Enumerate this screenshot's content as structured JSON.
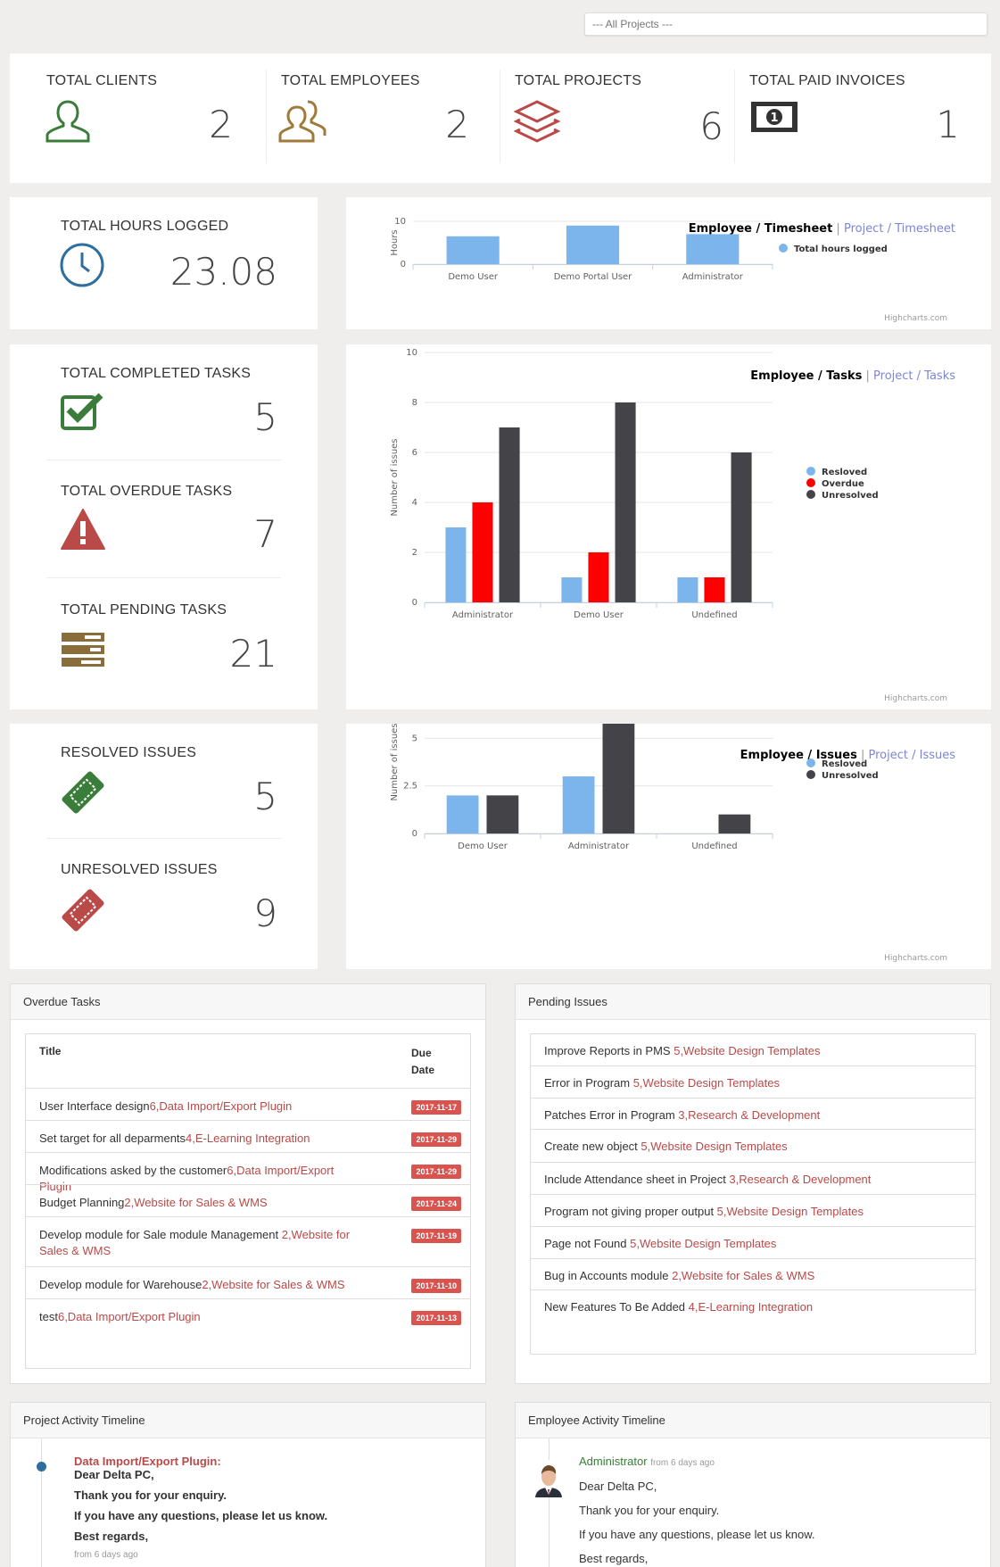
{
  "project_select": {
    "value": "--- All Projects ---"
  },
  "stats_top": [
    {
      "label": "TOTAL CLIENTS",
      "value": "2",
      "icon": "user-icon",
      "color": "#3a7d3a"
    },
    {
      "label": "TOTAL EMPLOYEES",
      "value": "2",
      "icon": "users-icon",
      "color": "#a07a3a"
    },
    {
      "label": "TOTAL PROJECTS",
      "value": "6",
      "icon": "layers-icon",
      "color": "#b94a48"
    },
    {
      "label": "TOTAL PAID INVOICES",
      "value": "1",
      "icon": "money-icon",
      "color": "#333333"
    }
  ],
  "hours": {
    "label": "TOTAL HOURS LOGGED",
    "value": "23.08",
    "icon": "clock-icon",
    "color": "#2f6f9f"
  },
  "tasks": [
    {
      "label": "TOTAL COMPLETED TASKS",
      "value": "5",
      "icon": "check-square-icon",
      "color": "#3a7d3a"
    },
    {
      "label": "TOTAL OVERDUE TASKS",
      "value": "7",
      "icon": "warning-icon",
      "color": "#b94a48"
    },
    {
      "label": "TOTAL PENDING TASKS",
      "value": "21",
      "icon": "tasks-icon",
      "color": "#8a6d3b"
    }
  ],
  "issues": [
    {
      "label": "RESOLVED ISSUES",
      "value": "5",
      "icon": "ticket-icon",
      "color": "#3a7d3a"
    },
    {
      "label": "UNRESOLVED ISSUES",
      "value": "9",
      "icon": "ticket-icon",
      "color": "#b94a48"
    }
  ],
  "chart_titles": {
    "timesheet": {
      "main": "Employee / Timesheet",
      "sep": " | ",
      "alt": "Project / Timesheet"
    },
    "tasks": {
      "main": "Employee / Tasks",
      "sep": " | ",
      "alt": "Project / Tasks"
    },
    "issues": {
      "main": "Employee / Issues",
      "sep": " | ",
      "alt": "Project / Issues"
    }
  },
  "credits": "Highcharts.com",
  "chart_data": [
    {
      "type": "bar",
      "categories": [
        "Demo User",
        "Demo Portal User",
        "Administrator"
      ],
      "series": [
        {
          "name": "Total hours logged",
          "values": [
            6.5,
            9,
            7
          ],
          "color": "#7cb5ec"
        }
      ],
      "ylabel": "Hours",
      "ylim": [
        0,
        10
      ],
      "yticks": [
        0,
        10
      ],
      "legend": "right",
      "grid": true
    },
    {
      "type": "bar",
      "categories": [
        "Administrator",
        "Demo User",
        "Undefined"
      ],
      "series": [
        {
          "name": "Resloved",
          "values": [
            3,
            1,
            1
          ],
          "color": "#7cb5ec"
        },
        {
          "name": "Overdue",
          "values": [
            4,
            2,
            1
          ],
          "color": "#ff0000"
        },
        {
          "name": "Unresolved",
          "values": [
            7,
            8,
            6
          ],
          "color": "#434348"
        }
      ],
      "ylabel": "Number of issues",
      "ylim": [
        0,
        10
      ],
      "yticks": [
        0,
        2,
        4,
        6,
        8,
        10
      ],
      "legend": "right",
      "grid": true
    },
    {
      "type": "bar",
      "categories": [
        "Demo User",
        "Administrator",
        "Undefined"
      ],
      "series": [
        {
          "name": "Resloved",
          "values": [
            2,
            3,
            0
          ],
          "color": "#7cb5ec"
        },
        {
          "name": "Unresolved",
          "values": [
            2,
            6,
            1
          ],
          "color": "#434348"
        }
      ],
      "ylabel": "Number of issues",
      "ylim": [
        0,
        7.5
      ],
      "yticks": [
        0,
        2.5,
        5,
        7.5
      ],
      "legend": "right",
      "grid": true
    }
  ],
  "overdue": {
    "title": "Overdue Tasks",
    "col_title": "Title",
    "col_due": "Due Date",
    "rows": [
      {
        "task": "User Interface design",
        "project": "6,Data Import/Export Plugin",
        "due": "2017-11-17"
      },
      {
        "task": "Set target for all deparments",
        "project": "4,E-Learning Integration",
        "due": "2017-11-29"
      },
      {
        "task": "Modifications asked by the customer",
        "project": "6,Data Import/Export Plugin",
        "due": "2017-11-29"
      },
      {
        "task": "Budget Planning",
        "project": "2,Website for Sales & WMS",
        "due": "2017-11-24"
      },
      {
        "task": "Develop module for Sale module Management ",
        "project": "2,Website for Sales & WMS",
        "due": "2017-11-19"
      },
      {
        "task": "Develop module for Warehouse",
        "project": "2,Website for Sales & WMS",
        "due": "2017-11-10"
      },
      {
        "task": "test",
        "project": "6,Data Import/Export Plugin",
        "due": "2017-11-13"
      }
    ]
  },
  "pending": {
    "title": "Pending Issues",
    "rows": [
      {
        "issue": "Improve Reports in PMS ",
        "project": "5,Website Design Templates"
      },
      {
        "issue": "Error in Program ",
        "project": "5,Website Design Templates"
      },
      {
        "issue": "Patches Error in Program ",
        "project": "3,Research & Development"
      },
      {
        "issue": "Create new object ",
        "project": "5,Website Design Templates"
      },
      {
        "issue": "Include Attendance sheet in Project ",
        "project": "3,Research & Development"
      },
      {
        "issue": "Program not giving proper output ",
        "project": "5,Website Design Templates"
      },
      {
        "issue": "Page not Found ",
        "project": "5,Website Design Templates"
      },
      {
        "issue": "Bug in Accounts module ",
        "project": "2,Website for Sales & WMS"
      },
      {
        "issue": "New Features To Be Added ",
        "project": "4,E-Learning Integration"
      }
    ]
  },
  "project_timeline": {
    "title": "Project Activity Timeline",
    "project": "Data Import/Export Plugin:",
    "lines": [
      "Dear Delta PC,",
      "Thank you for your enquiry.",
      "If you have any questions, please let us know.",
      "Best regards,"
    ],
    "time": "from 6 days ago"
  },
  "employee_timeline": {
    "title": "Employee Activity Timeline",
    "user": "Administrator",
    "time": "from 6 days ago",
    "lines": [
      "Dear Delta PC,",
      "Thank you for your enquiry.",
      "If you have any questions, please let us know.",
      "Best regards,"
    ]
  }
}
